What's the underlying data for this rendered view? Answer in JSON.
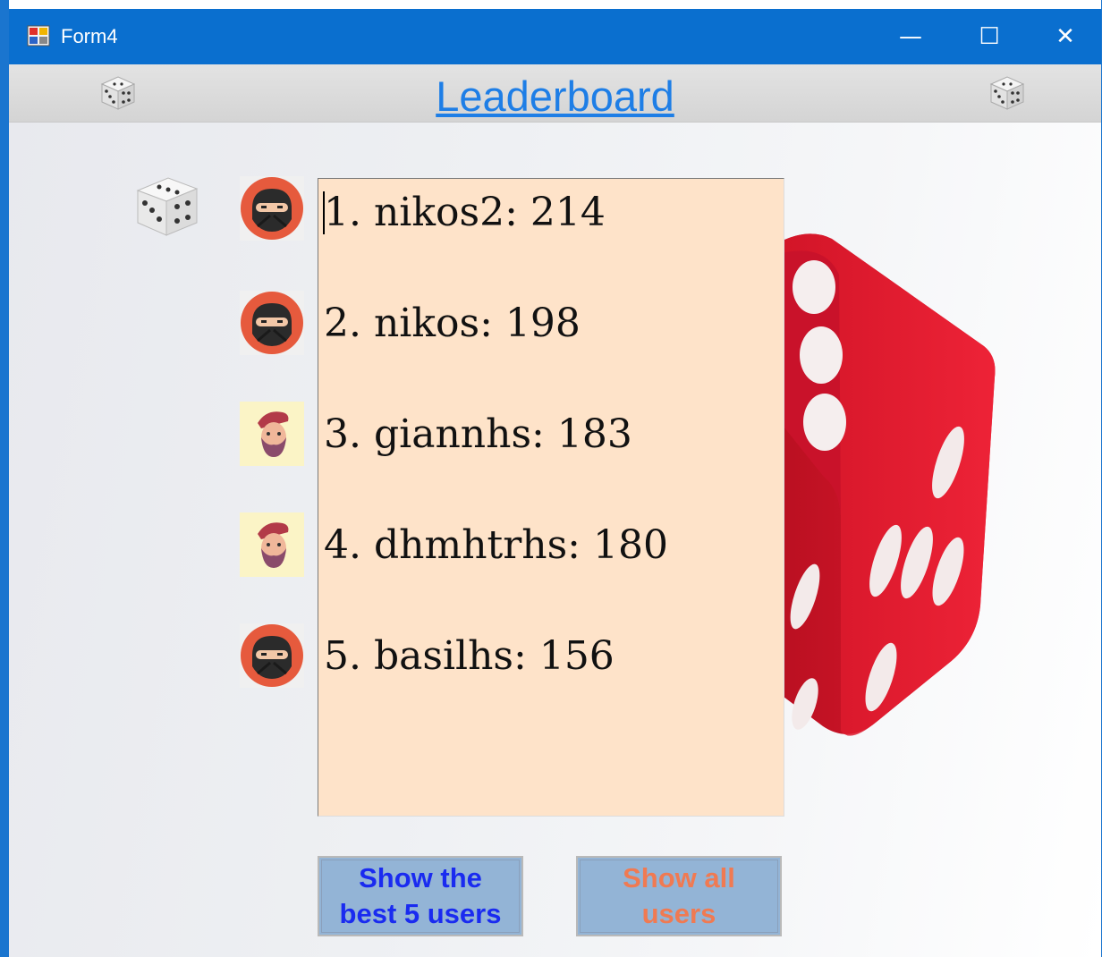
{
  "window": {
    "title": "Form4",
    "controls": {
      "minimize": "—",
      "maximize": "☐",
      "close": "✕"
    }
  },
  "header": {
    "title": "Leaderboard"
  },
  "leaderboard": {
    "entries": [
      {
        "text": "1. nikos2: 214",
        "avatar": "ninja-avatar-icon"
      },
      {
        "text": "2. nikos: 198",
        "avatar": "ninja-avatar-icon"
      },
      {
        "text": "3. giannhs: 183",
        "avatar": "hipster-avatar-icon"
      },
      {
        "text": "4. dhmhtrhs: 180",
        "avatar": "hipster-avatar-icon"
      },
      {
        "text": "5. basilhs: 156",
        "avatar": "ninja-avatar-icon"
      }
    ]
  },
  "buttons": {
    "best5": "Show the best 5 users",
    "all": "Show all users"
  },
  "colors": {
    "titlebar": "#0a6fcf",
    "heading": "#1e7ee6",
    "listbox": "#fee3c9",
    "button_bg": "#93b4d6",
    "button_best_text": "#1a2bf0",
    "button_all_text": "#f07a52",
    "dice": "#d8152c"
  }
}
